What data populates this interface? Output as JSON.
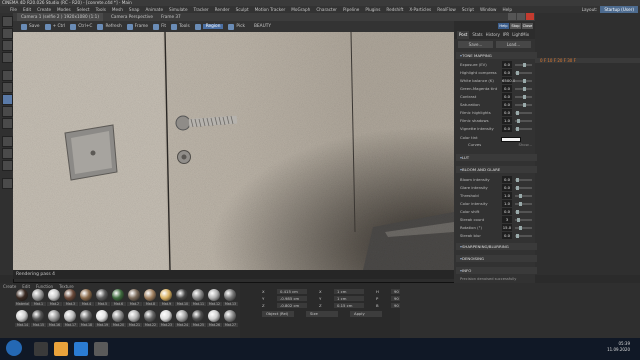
{
  "app": {
    "title": "CINEMA 4D R20.026 Studio (RC - R20) - [conrete.c4d *] - Main",
    "menu": [
      "File",
      "Edit",
      "Create",
      "Modes",
      "Select",
      "Tools",
      "Mesh",
      "Snap",
      "Animate",
      "Simulate",
      "Tracker",
      "Render",
      "Sculpt",
      "Motion Tracker",
      "MoGraph",
      "Character",
      "Pipeline",
      "Plugins",
      "Redshift",
      "X-Particles",
      "RealFlow",
      "Script",
      "Window",
      "Help"
    ],
    "layout_label": "Layout:",
    "layout_value": "Startup (User)",
    "timeline_keys": "0 F   10 F   20 F   30 F",
    "material_tabs": [
      "Create",
      "Edit",
      "Function",
      "Texture"
    ],
    "materials": [
      {
        "name": "Material",
        "color": "#3a2a22"
      },
      {
        "name": "Mat.1",
        "color": "#9b9b9b"
      },
      {
        "name": "Mat.2",
        "color": "#c9c9c9"
      },
      {
        "name": "Mat.3",
        "color": "#6b4a3a"
      },
      {
        "name": "Mat.4",
        "color": "#8a6a4a"
      },
      {
        "name": "Mat.5",
        "color": "#5b5b5b"
      },
      {
        "name": "Mat.6",
        "color": "#3e6b3e"
      },
      {
        "name": "Mat.7",
        "color": "#7a6a5a"
      },
      {
        "name": "Mat.8",
        "color": "#a08060"
      },
      {
        "name": "Mat.9",
        "color": "#d8b060"
      },
      {
        "name": "Mat.10",
        "color": "#444"
      },
      {
        "name": "Mat.11",
        "color": "#888"
      },
      {
        "name": "Mat.12",
        "color": "#b0b0b0"
      },
      {
        "name": "Mat.13",
        "color": "#777"
      },
      {
        "name": "Mat.14",
        "color": "#cfcfcf"
      },
      {
        "name": "Mat.15",
        "color": "#555"
      },
      {
        "name": "Mat.16",
        "color": "#999"
      },
      {
        "name": "Mat.17",
        "color": "#c0c0c0"
      },
      {
        "name": "Mat.18",
        "color": "#6a6a6a"
      },
      {
        "name": "Mat.19",
        "color": "#e2e2e2"
      },
      {
        "name": "Mat.20",
        "color": "#8d8d8d"
      },
      {
        "name": "Mat.21",
        "color": "#b5b5b5"
      },
      {
        "name": "Mat.22",
        "color": "#666"
      },
      {
        "name": "Mat.23",
        "color": "#dcdcdc"
      },
      {
        "name": "Mat.24",
        "color": "#a5a5a5"
      },
      {
        "name": "Mat.25",
        "color": "#4f4f4f"
      },
      {
        "name": "Mat.26",
        "color": "#cfcfcf"
      },
      {
        "name": "Mat.27",
        "color": "#8a8a8a"
      }
    ],
    "coords": [
      [
        "X",
        "0.415 cm",
        "X",
        "1 cm",
        "H",
        "90 °"
      ],
      [
        "Y",
        "-0.985 cm",
        "Y",
        "1 cm",
        "P",
        "90 °"
      ],
      [
        "Z",
        "-0.802 cm",
        "Z",
        "0.15 cm",
        "B",
        "90 °"
      ]
    ],
    "coord_mode": "Object (Rel)",
    "coord_size": "Size",
    "apply": "Apply",
    "clock_time": "05:39",
    "clock_date": "11.09.2020"
  },
  "viewer": {
    "title_tab": "Camera 1 (selfie 2 ) 1920x1080 (1:1)",
    "title_tab2": "Camera Perspective",
    "title_tab3": "Frame 37",
    "toolbar": [
      {
        "icon": "save-icon",
        "label": "Save"
      },
      {
        "icon": "snapshot-icon",
        "label": "+ Ctrl"
      },
      {
        "icon": "ctrl-icon",
        "label": "Ctrl+C"
      },
      {
        "icon": "refresh-icon",
        "label": "Refresh"
      },
      {
        "icon": "frame-icon",
        "label": "Frame"
      },
      {
        "icon": "fit-icon",
        "label": "Fit"
      },
      {
        "icon": "tools-icon",
        "label": "Tools"
      },
      {
        "icon": "region-icon",
        "label": "Region"
      },
      {
        "icon": "pick-icon",
        "label": "Pick"
      }
    ],
    "aov": "BEAUTY",
    "status": "Rendering pass 4"
  },
  "post": {
    "header_buttons": [
      "Help",
      "Stop",
      "Close"
    ],
    "tabs": [
      "Post",
      "Stats",
      "History",
      "IPR",
      "LightMix"
    ],
    "save": "Save...",
    "load": "Load...",
    "sections": {
      "tone": "TONE MAPPING",
      "lut": "LUT",
      "bloom": "BLOOM AND GLARE",
      "sharpen": "SHARPENING/BLURRING",
      "denoise": "DENOISING",
      "info": "INFO"
    },
    "tone_params": [
      {
        "label": "Exposure (EV)",
        "value": "0.0",
        "level": 0.5
      },
      {
        "label": "Highlight compress",
        "value": "0.0",
        "level": 0.1
      },
      {
        "label": "White balance (K)",
        "value": "6500.0",
        "level": 0.5
      },
      {
        "label": "Green-Magenta tint",
        "value": "0.0",
        "level": 0.5
      },
      {
        "label": "Contrast",
        "value": "0.0",
        "level": 0.5
      },
      {
        "label": "Saturation",
        "value": "0.0",
        "level": 0.5
      },
      {
        "label": "Filmic highlights",
        "value": "0.0",
        "level": 0.1
      },
      {
        "label": "Filmic shadows",
        "value": "1.0",
        "level": 0.2
      },
      {
        "label": "Vignette intensity",
        "value": "0.0",
        "level": 0.1
      }
    ],
    "color_tint_label": "Color tint",
    "curves_label": "Curves",
    "curves_button": "Show...",
    "bloom_params": [
      {
        "label": "Bloom intensity",
        "value": "0.0",
        "level": 0.1
      },
      {
        "label": "Glare intensity",
        "value": "0.0",
        "level": 0.1
      },
      {
        "label": "Threshold",
        "value": "1.0",
        "level": 0.3
      },
      {
        "label": "Color intensity",
        "value": "1.0",
        "level": 0.3
      },
      {
        "label": "Color shift",
        "value": "0.0",
        "level": 0.1
      },
      {
        "label": "Streak count",
        "value": "3",
        "level": 0.2
      },
      {
        "label": "Rotation (°)",
        "value": "15.0",
        "level": 0.3
      },
      {
        "label": "Streak blur",
        "value": "0.0",
        "level": 0.1
      }
    ],
    "info_text": "Precision denoised successfully"
  }
}
